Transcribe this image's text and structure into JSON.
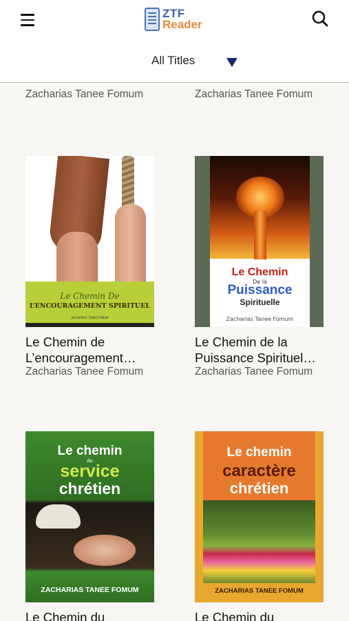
{
  "header": {
    "logo_line1": "ZTF",
    "logo_line2": "Reader"
  },
  "filter": {
    "label": "All Titles"
  },
  "books": [
    {
      "title": "",
      "author": "Zacharias Tanee Fomum"
    },
    {
      "title": "",
      "author": "Zacharias Tanee Fomum"
    },
    {
      "title": "Le Chemin de L’encouragement…",
      "title_line1": "Le Chemin de",
      "title_line2": "L’encouragement…",
      "author": "Zacharias Tanee Fomum",
      "cover": {
        "script": "Le Chemin De",
        "title": "L’ENCOURAGEMENT SPIRITUEL",
        "author": "ZACHARIAS TANEE FOMUM"
      }
    },
    {
      "title_line1": "Le Chemin de la",
      "title_line2": "Puissance Spirituel…",
      "author": "Zacharias Tanee Fomum",
      "cover": {
        "l1": "Le Chemin",
        "l2": "De la",
        "l3": "Puissance",
        "l4": "Spirituelle",
        "author": "Zacharias Tanee Fomum"
      }
    },
    {
      "title_line1": "Le Chemin du",
      "author": "",
      "cover": {
        "l1": "Le chemin",
        "l2": "du",
        "l3": "service",
        "l4": "chrétien",
        "author": "ZACHARIAS TANEE FOMUM"
      }
    },
    {
      "title_line1": "Le Chemin du",
      "author": "",
      "cover": {
        "l1": "Le chemin",
        "l2": "caractère",
        "l3": "chrétien",
        "author": "ZACHARIAS TANEE FOMUM"
      }
    }
  ],
  "colors": {
    "background": "#f7f6f3",
    "caret": "#1a2a6c",
    "logo_blue": "#3b5ea8",
    "logo_orange": "#e8873a"
  }
}
